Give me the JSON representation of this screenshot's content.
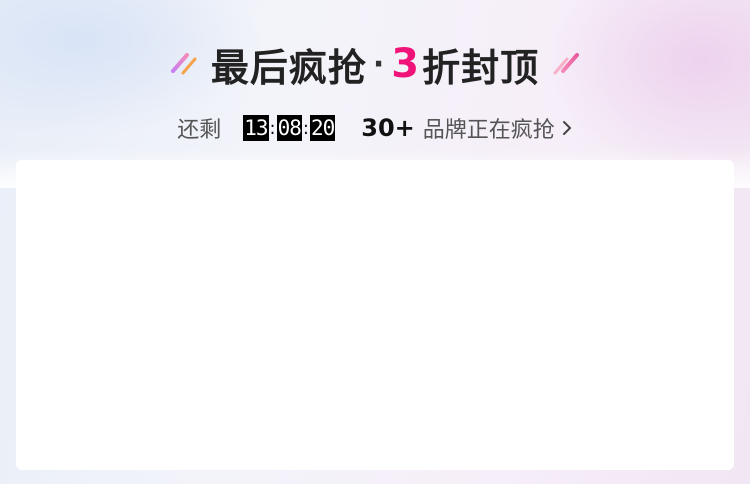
{
  "banner": {
    "title_part1": "最后疯抢",
    "separator": "·",
    "title_number": "3",
    "title_part2": "折封顶",
    "number_color": "#f0147a",
    "left_deco_icon": "slash-decoration-icon",
    "right_deco_icon": "slash-decoration-icon"
  },
  "countdown": {
    "prefix": "还剩",
    "hours": "13",
    "minutes": "08",
    "seconds": "20",
    "colon": ":"
  },
  "brands_link": {
    "count": "30+",
    "label": "品牌正在疯抢",
    "icon": "chevron-right-icon"
  }
}
